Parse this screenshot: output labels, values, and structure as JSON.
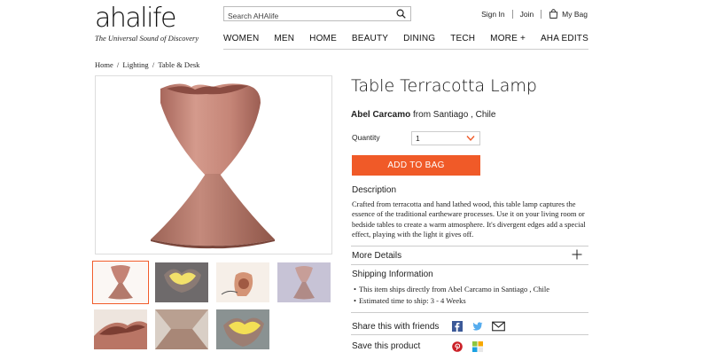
{
  "header": {
    "logo_text": "ahalife",
    "tagline": "The Universal Sound of Discovery",
    "search_placeholder": "Search AHAlife",
    "sign_in": "Sign In",
    "join": "Join",
    "bag": "My Bag"
  },
  "nav": {
    "women": "WOMEN",
    "men": "MEN",
    "home": "HOME",
    "beauty": "BEAUTY",
    "dining": "DINING",
    "tech": "TECH",
    "more": "MORE +",
    "aha_edits": "AHA EDITS"
  },
  "breadcrumb": [
    "Home",
    "Lighting",
    "Table & Desk"
  ],
  "product": {
    "title": "Table Terracotta Lamp",
    "designer": "Abel Carcamo",
    "from_text": " from Santiago , Chile",
    "quantity_label": "Quantity",
    "quantity_value": "1",
    "add_to_bag": "ADD TO BAG",
    "description_title": "Description",
    "description": "Crafted from terracotta and hand lathed wood, this table lamp captures the essence of the traditional eartheware processes. Use it on your living room or bedside tables to create a warm atmosphere. It's divergent edges add a special effect, playing with the light it gives off.",
    "more_details": "More Details",
    "shipping_title": "Shipping Information",
    "shipping_items": [
      "This item ships directly from Abel Carcamo in Santiago , Chile",
      "Estimated time to ship: 3 - 4 Weeks"
    ],
    "share_label": "Share this with friends",
    "save_label": "Save this product"
  },
  "colors": {
    "accent": "#f05a28",
    "terracotta": "#c9877a",
    "facebook": "#3b5998",
    "twitter": "#55acee",
    "pinterest": "#cb2027"
  },
  "icons": [
    "search-icon",
    "bag-icon",
    "chevron-down-icon",
    "plus-icon",
    "facebook-icon",
    "twitter-icon",
    "email-icon",
    "pinterest-icon",
    "bookmark-icon"
  ]
}
